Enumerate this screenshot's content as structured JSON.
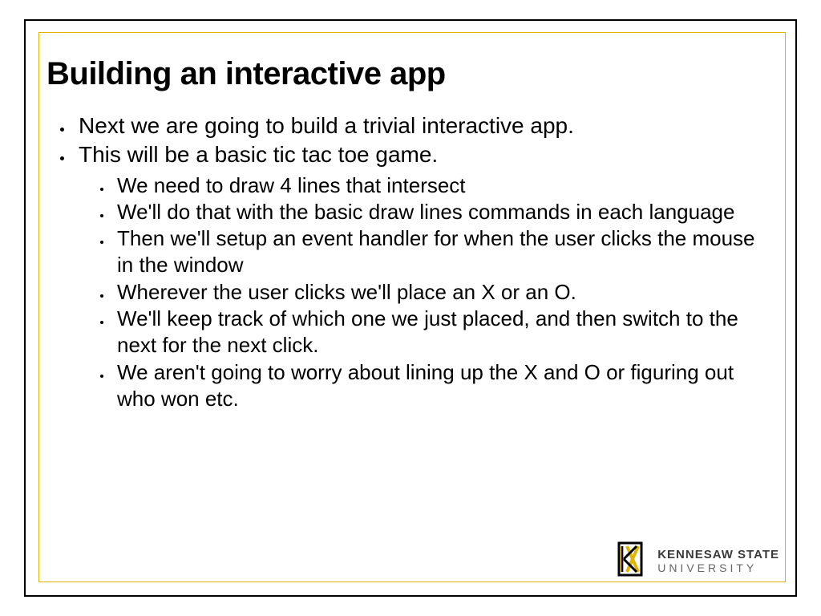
{
  "slide": {
    "title": "Building an interactive app",
    "bullets": [
      "Next we are going to build a trivial interactive app.",
      "This will be a basic tic tac toe game."
    ],
    "sub_bullets": [
      "We need to draw 4 lines that intersect",
      "We'll do that with the basic draw lines commands in each language",
      "Then we'll setup an event handler for when the user clicks the mouse in the window",
      "Wherever the user clicks we'll place an X or an O.",
      "We'll keep track of which one we just placed, and then switch to the next for the next click.",
      "We aren't going to worry about lining up the X and O or figuring out who won etc."
    ]
  },
  "branding": {
    "name_line1": "KENNESAW STATE",
    "name_line2": "UNIVERSITY",
    "accent_color": "#e0b400"
  }
}
